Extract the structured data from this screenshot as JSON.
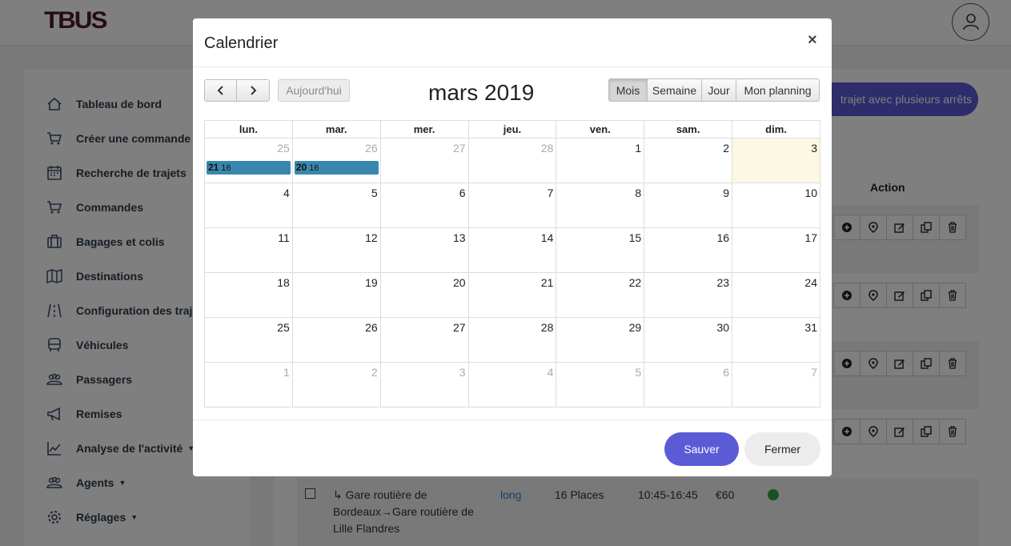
{
  "app": {
    "logo": "TBUS"
  },
  "sidebar": {
    "items": [
      {
        "label": "Tableau de bord",
        "icon": "home-icon"
      },
      {
        "label": "Créer une commande",
        "icon": "cart-icon"
      },
      {
        "label": "Recherche de trajets",
        "icon": "calendar-icon"
      },
      {
        "label": "Commandes",
        "icon": "cart-icon"
      },
      {
        "label": "Bagages et colis",
        "icon": "luggage-icon"
      },
      {
        "label": "Destinations",
        "icon": "map-icon"
      },
      {
        "label": "Configuration des trajets",
        "icon": "road-icon"
      },
      {
        "label": "Véhicules",
        "icon": "bus-icon"
      },
      {
        "label": "Passagers",
        "icon": "users-icon"
      },
      {
        "label": "Remises",
        "icon": "megaphone-icon"
      },
      {
        "label": "Analyse de l'activité",
        "icon": "chart-icon",
        "has_caret": true
      },
      {
        "label": "Agents",
        "icon": "users-icon",
        "has_caret": true
      },
      {
        "label": "Réglages",
        "icon": "gear-icon",
        "has_caret": true
      }
    ]
  },
  "main": {
    "add_trip_label": "trajet avec plusieurs arrêts",
    "action_header": "Action",
    "row": {
      "route": "↳ Gare routière de Bordeaux→Gare routière de Lille Flandres",
      "type": "long",
      "places": "16 Places",
      "time": "10:45-16:45",
      "price": "€60"
    }
  },
  "modal": {
    "title": "Calendrier",
    "close_symbol": "×",
    "today_label": "Aujourd'hui",
    "month_title": "mars 2019",
    "views": [
      "Mois",
      "Semaine",
      "Jour",
      "Mon planning"
    ],
    "active_view": "Mois",
    "weekdays": [
      "lun.",
      "mar.",
      "mer.",
      "jeu.",
      "ven.",
      "sam.",
      "dim."
    ],
    "weeks": [
      [
        {
          "d": "25",
          "o": true
        },
        {
          "d": "26",
          "o": true
        },
        {
          "d": "27",
          "o": true
        },
        {
          "d": "28",
          "o": true
        },
        {
          "d": "1"
        },
        {
          "d": "2"
        },
        {
          "d": "3",
          "today": true
        }
      ],
      [
        {
          "d": "4"
        },
        {
          "d": "5"
        },
        {
          "d": "6"
        },
        {
          "d": "7"
        },
        {
          "d": "8"
        },
        {
          "d": "9"
        },
        {
          "d": "10"
        }
      ],
      [
        {
          "d": "11"
        },
        {
          "d": "12"
        },
        {
          "d": "13"
        },
        {
          "d": "14"
        },
        {
          "d": "15"
        },
        {
          "d": "16"
        },
        {
          "d": "17"
        }
      ],
      [
        {
          "d": "18"
        },
        {
          "d": "19"
        },
        {
          "d": "20"
        },
        {
          "d": "21"
        },
        {
          "d": "22"
        },
        {
          "d": "23"
        },
        {
          "d": "24"
        }
      ],
      [
        {
          "d": "25"
        },
        {
          "d": "26"
        },
        {
          "d": "27"
        },
        {
          "d": "28"
        },
        {
          "d": "29"
        },
        {
          "d": "30"
        },
        {
          "d": "31"
        }
      ],
      [
        {
          "d": "1",
          "o": true
        },
        {
          "d": "2",
          "o": true
        },
        {
          "d": "3",
          "o": true
        },
        {
          "d": "4",
          "o": true
        },
        {
          "d": "5",
          "o": true
        },
        {
          "d": "6",
          "o": true
        },
        {
          "d": "7",
          "o": true
        }
      ]
    ],
    "events": [
      {
        "week": 0,
        "day": 0,
        "time": "21",
        "title": "16"
      },
      {
        "week": 0,
        "day": 1,
        "time": "20",
        "title": "16"
      }
    ],
    "save_label": "Sauver",
    "close_label": "Fermer"
  },
  "colors": {
    "accent": "#5b5bd6",
    "event": "#3a87ad",
    "today": "#fcf8e3",
    "logo": "#4a1a2c"
  }
}
